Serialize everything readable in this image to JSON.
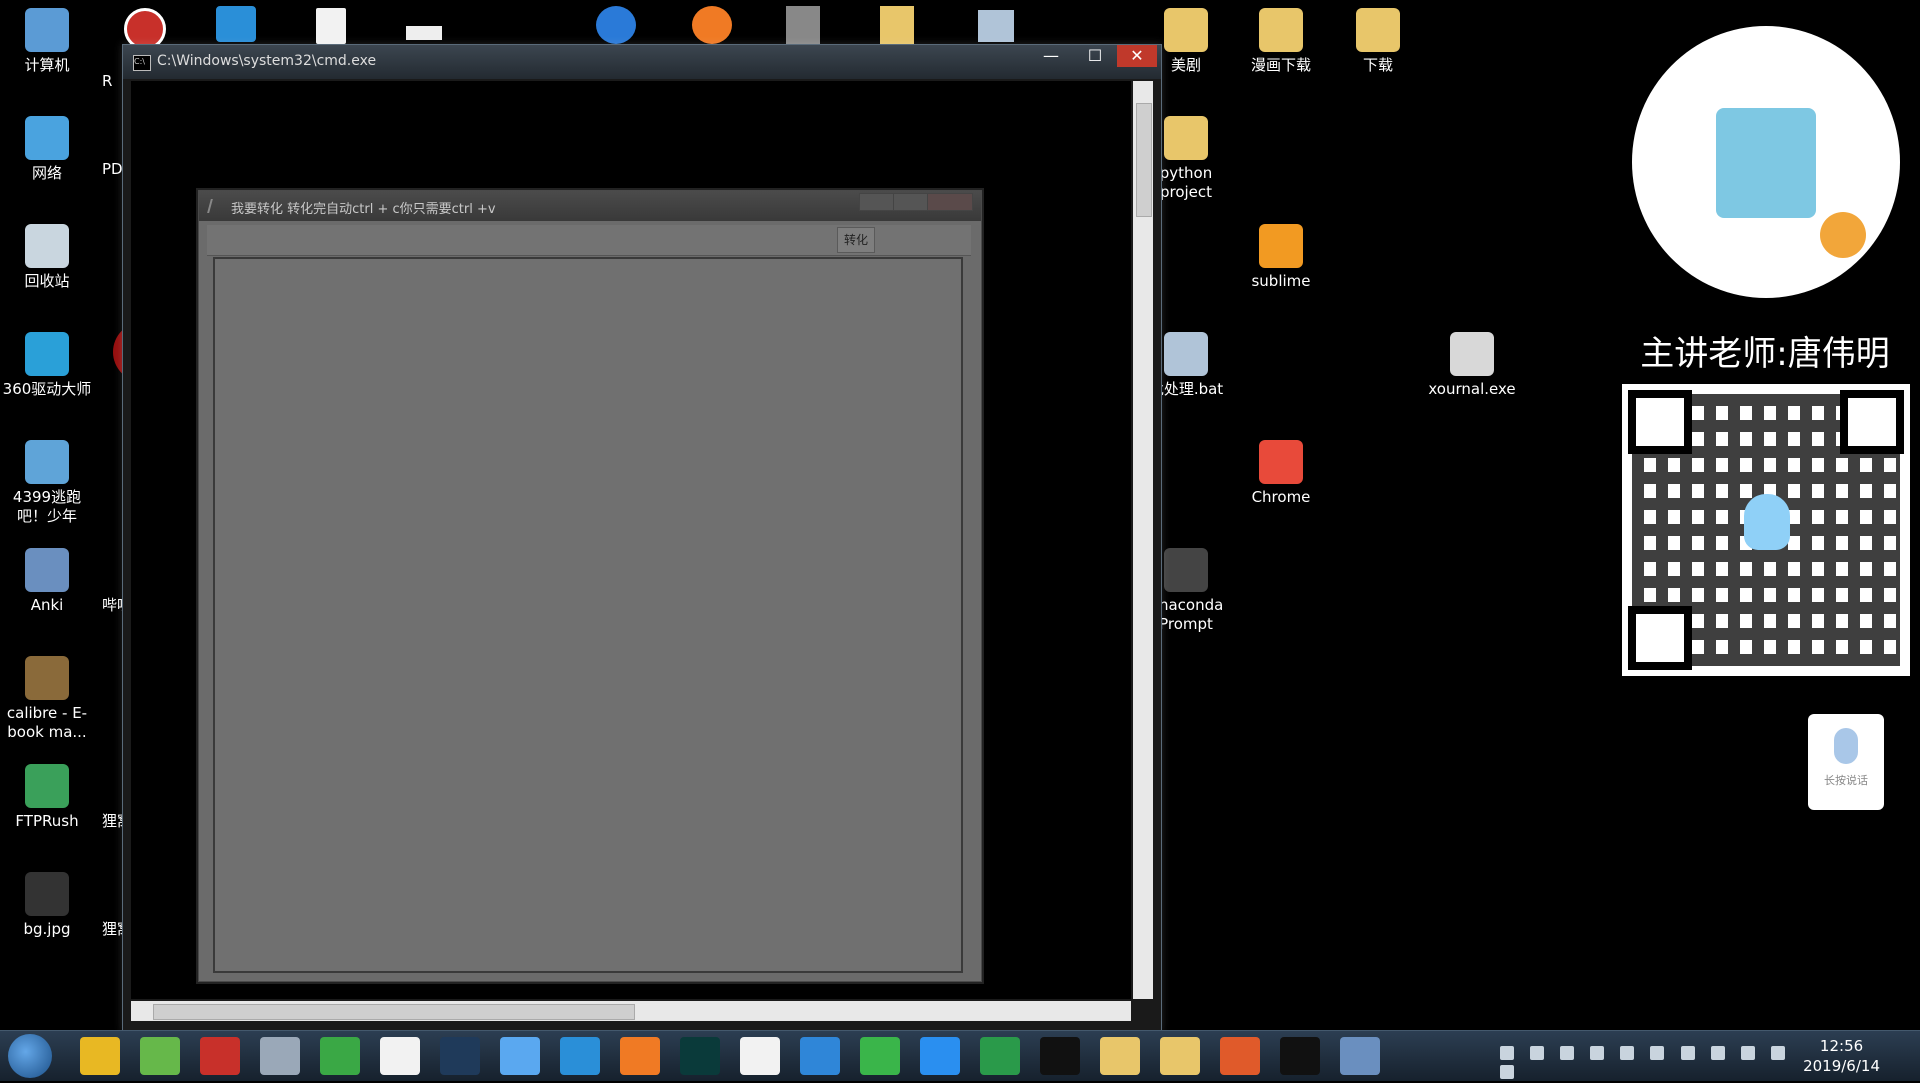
{
  "desktop_left": [
    {
      "label": "计算机",
      "color": "#5b9bd5"
    },
    {
      "label": "网络",
      "color": "#4aa3df"
    },
    {
      "label": "回收站",
      "color": "#c9d6df"
    },
    {
      "label": "360驱动大师",
      "color": "#2aa0d8"
    },
    {
      "label": "4399逃跑吧！少年",
      "color": "#5fa4d8"
    },
    {
      "label": "Anki",
      "color": "#6a8fbf"
    },
    {
      "label": "calibre - E-book ma...",
      "color": "#8a6a3a"
    },
    {
      "label": "FTPRush",
      "color": "#3aa05a"
    },
    {
      "label": "bg.jpg",
      "color": "#333333"
    }
  ],
  "desktop_partial_left": [
    "R",
    "PD",
    "哔哩",
    "狸窝",
    "狸窝"
  ],
  "desktop_right": [
    {
      "label": "美剧",
      "color": "#e8c66a"
    },
    {
      "label": "漫画下载",
      "color": "#e8c66a"
    },
    {
      "label": "下载",
      "color": "#e8c66a"
    },
    {
      "label": "python project",
      "color": "#e8c66a"
    },
    {
      "label": "sublime",
      "color": "#f29a22"
    },
    {
      "label": "批处理.bat",
      "color": "#b0c4d8"
    },
    {
      "label": "xournal.exe",
      "color": "#d8d8d8"
    },
    {
      "label": "Chrome",
      "color": "#e84a3a"
    },
    {
      "label": "Anaconda Prompt",
      "color": "#444444"
    }
  ],
  "cmd_window": {
    "title": "C:\\Windows\\system32\\cmd.exe",
    "minimize": "—",
    "maximize": "☐",
    "close": "✕",
    "icon_label": "C:\\"
  },
  "app_window": {
    "title": "我要转化 转化完自动ctrl + c你只需要ctrl +v",
    "convert_label": "转化"
  },
  "right_panel": {
    "teacher": "主讲老师:唐伟明",
    "voice_hint": "长按说话"
  },
  "taskbar": {
    "time": "12:56",
    "date": "2019/6/14",
    "items": [
      {
        "name": "pdf-icon",
        "color": "#e8b823"
      },
      {
        "name": "refresh-icon",
        "color": "#66b84a"
      },
      {
        "name": "book-red-icon",
        "color": "#c8302a"
      },
      {
        "name": "qq-icon",
        "color": "#9aa8b8"
      },
      {
        "name": "browser-icon",
        "color": "#3aa845"
      },
      {
        "name": "manga-icon",
        "color": "#f2f2f2"
      },
      {
        "name": "photoshop-icon",
        "color": "#1f3a5a"
      },
      {
        "name": "app-blue-icon",
        "color": "#5aa8f0"
      },
      {
        "name": "bird-icon",
        "color": "#2a8fd8"
      },
      {
        "name": "firefox-icon",
        "color": "#f07a24"
      },
      {
        "name": "audition-icon",
        "color": "#0a3a3a"
      },
      {
        "name": "baidu-pan-icon",
        "color": "#f2f2f2"
      },
      {
        "name": "reader-icon",
        "color": "#2f86d8"
      },
      {
        "name": "wechat-icon",
        "color": "#3ab54a"
      },
      {
        "name": "star-icon",
        "color": "#2a8ff0"
      },
      {
        "name": "excel-icon",
        "color": "#2a9a4a"
      },
      {
        "name": "pycharm-icon",
        "color": "#111111"
      },
      {
        "name": "folder-icon-1",
        "color": "#e8c66a"
      },
      {
        "name": "folder-icon-2",
        "color": "#e8c66a"
      },
      {
        "name": "avatar-icon",
        "color": "#e05a2a"
      },
      {
        "name": "cmd-icon",
        "color": "#111111"
      },
      {
        "name": "feather-icon",
        "color": "#6a8fbf"
      }
    ]
  }
}
